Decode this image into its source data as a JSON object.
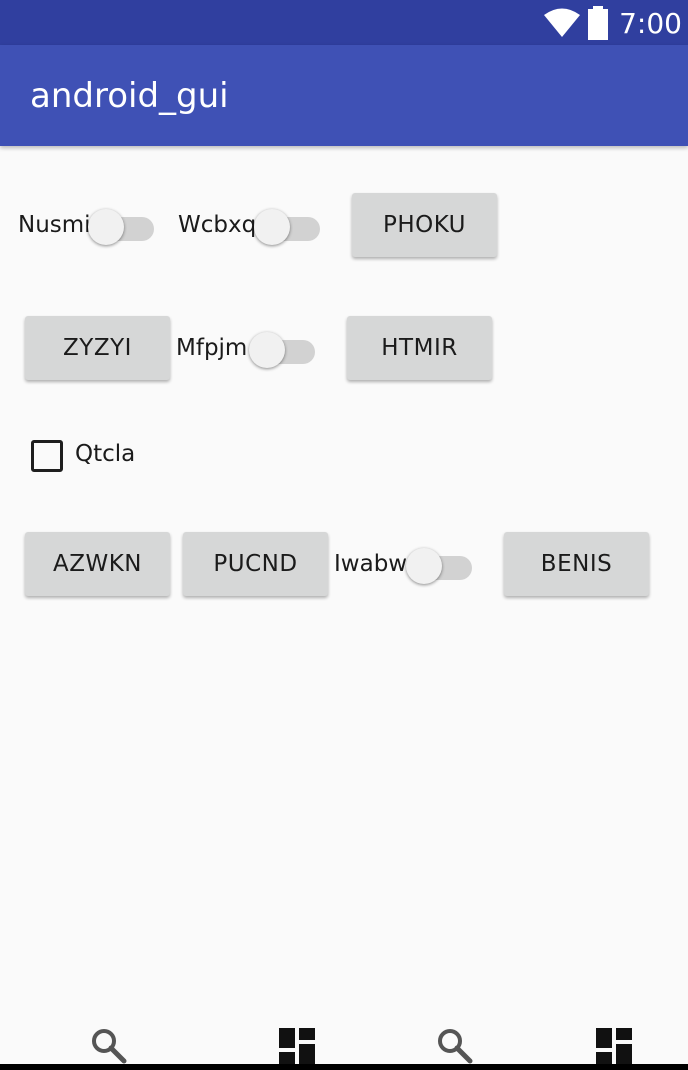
{
  "status_bar": {
    "time": "7:00",
    "icons": [
      "wifi-icon",
      "battery-icon"
    ],
    "background": "#303f9f"
  },
  "app_bar": {
    "title": "android_gui",
    "background": "#3f51b5"
  },
  "content": {
    "row1": {
      "switch1_label": "Nusmi",
      "switch2_label": "Wcbxq",
      "button_label": "PHOKU"
    },
    "row2": {
      "button1_label": "ZYZYI",
      "switch_label": "Mfpjm",
      "button2_label": "HTMIR"
    },
    "row3": {
      "checkbox_label": "Qtcla",
      "checked": false
    },
    "row4": {
      "button1_label": "AZWKN",
      "button2_label": "PUCND",
      "switch_label": "Iwabw",
      "button3_label": "BENIS"
    }
  },
  "bottom_nav": {
    "icons": [
      "search-icon",
      "dashboard-icon",
      "search-icon",
      "dashboard-icon"
    ]
  }
}
